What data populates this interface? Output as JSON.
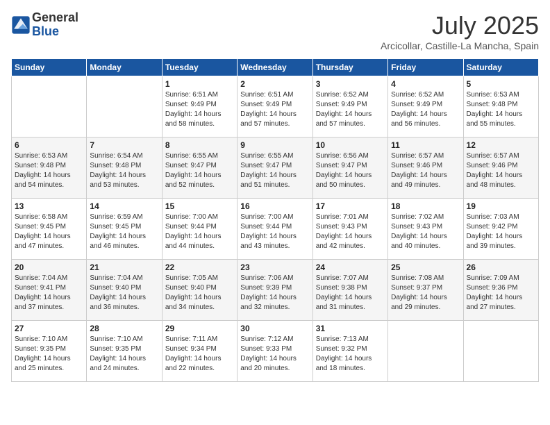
{
  "header": {
    "logo_general": "General",
    "logo_blue": "Blue",
    "month_year": "July 2025",
    "location": "Arcicollar, Castille-La Mancha, Spain"
  },
  "weekdays": [
    "Sunday",
    "Monday",
    "Tuesday",
    "Wednesday",
    "Thursday",
    "Friday",
    "Saturday"
  ],
  "weeks": [
    [
      {
        "day": "",
        "sunrise": "",
        "sunset": "",
        "daylight": ""
      },
      {
        "day": "",
        "sunrise": "",
        "sunset": "",
        "daylight": ""
      },
      {
        "day": "1",
        "sunrise": "Sunrise: 6:51 AM",
        "sunset": "Sunset: 9:49 PM",
        "daylight": "Daylight: 14 hours and 58 minutes."
      },
      {
        "day": "2",
        "sunrise": "Sunrise: 6:51 AM",
        "sunset": "Sunset: 9:49 PM",
        "daylight": "Daylight: 14 hours and 57 minutes."
      },
      {
        "day": "3",
        "sunrise": "Sunrise: 6:52 AM",
        "sunset": "Sunset: 9:49 PM",
        "daylight": "Daylight: 14 hours and 57 minutes."
      },
      {
        "day": "4",
        "sunrise": "Sunrise: 6:52 AM",
        "sunset": "Sunset: 9:49 PM",
        "daylight": "Daylight: 14 hours and 56 minutes."
      },
      {
        "day": "5",
        "sunrise": "Sunrise: 6:53 AM",
        "sunset": "Sunset: 9:48 PM",
        "daylight": "Daylight: 14 hours and 55 minutes."
      }
    ],
    [
      {
        "day": "6",
        "sunrise": "Sunrise: 6:53 AM",
        "sunset": "Sunset: 9:48 PM",
        "daylight": "Daylight: 14 hours and 54 minutes."
      },
      {
        "day": "7",
        "sunrise": "Sunrise: 6:54 AM",
        "sunset": "Sunset: 9:48 PM",
        "daylight": "Daylight: 14 hours and 53 minutes."
      },
      {
        "day": "8",
        "sunrise": "Sunrise: 6:55 AM",
        "sunset": "Sunset: 9:47 PM",
        "daylight": "Daylight: 14 hours and 52 minutes."
      },
      {
        "day": "9",
        "sunrise": "Sunrise: 6:55 AM",
        "sunset": "Sunset: 9:47 PM",
        "daylight": "Daylight: 14 hours and 51 minutes."
      },
      {
        "day": "10",
        "sunrise": "Sunrise: 6:56 AM",
        "sunset": "Sunset: 9:47 PM",
        "daylight": "Daylight: 14 hours and 50 minutes."
      },
      {
        "day": "11",
        "sunrise": "Sunrise: 6:57 AM",
        "sunset": "Sunset: 9:46 PM",
        "daylight": "Daylight: 14 hours and 49 minutes."
      },
      {
        "day": "12",
        "sunrise": "Sunrise: 6:57 AM",
        "sunset": "Sunset: 9:46 PM",
        "daylight": "Daylight: 14 hours and 48 minutes."
      }
    ],
    [
      {
        "day": "13",
        "sunrise": "Sunrise: 6:58 AM",
        "sunset": "Sunset: 9:45 PM",
        "daylight": "Daylight: 14 hours and 47 minutes."
      },
      {
        "day": "14",
        "sunrise": "Sunrise: 6:59 AM",
        "sunset": "Sunset: 9:45 PM",
        "daylight": "Daylight: 14 hours and 46 minutes."
      },
      {
        "day": "15",
        "sunrise": "Sunrise: 7:00 AM",
        "sunset": "Sunset: 9:44 PM",
        "daylight": "Daylight: 14 hours and 44 minutes."
      },
      {
        "day": "16",
        "sunrise": "Sunrise: 7:00 AM",
        "sunset": "Sunset: 9:44 PM",
        "daylight": "Daylight: 14 hours and 43 minutes."
      },
      {
        "day": "17",
        "sunrise": "Sunrise: 7:01 AM",
        "sunset": "Sunset: 9:43 PM",
        "daylight": "Daylight: 14 hours and 42 minutes."
      },
      {
        "day": "18",
        "sunrise": "Sunrise: 7:02 AM",
        "sunset": "Sunset: 9:43 PM",
        "daylight": "Daylight: 14 hours and 40 minutes."
      },
      {
        "day": "19",
        "sunrise": "Sunrise: 7:03 AM",
        "sunset": "Sunset: 9:42 PM",
        "daylight": "Daylight: 14 hours and 39 minutes."
      }
    ],
    [
      {
        "day": "20",
        "sunrise": "Sunrise: 7:04 AM",
        "sunset": "Sunset: 9:41 PM",
        "daylight": "Daylight: 14 hours and 37 minutes."
      },
      {
        "day": "21",
        "sunrise": "Sunrise: 7:04 AM",
        "sunset": "Sunset: 9:40 PM",
        "daylight": "Daylight: 14 hours and 36 minutes."
      },
      {
        "day": "22",
        "sunrise": "Sunrise: 7:05 AM",
        "sunset": "Sunset: 9:40 PM",
        "daylight": "Daylight: 14 hours and 34 minutes."
      },
      {
        "day": "23",
        "sunrise": "Sunrise: 7:06 AM",
        "sunset": "Sunset: 9:39 PM",
        "daylight": "Daylight: 14 hours and 32 minutes."
      },
      {
        "day": "24",
        "sunrise": "Sunrise: 7:07 AM",
        "sunset": "Sunset: 9:38 PM",
        "daylight": "Daylight: 14 hours and 31 minutes."
      },
      {
        "day": "25",
        "sunrise": "Sunrise: 7:08 AM",
        "sunset": "Sunset: 9:37 PM",
        "daylight": "Daylight: 14 hours and 29 minutes."
      },
      {
        "day": "26",
        "sunrise": "Sunrise: 7:09 AM",
        "sunset": "Sunset: 9:36 PM",
        "daylight": "Daylight: 14 hours and 27 minutes."
      }
    ],
    [
      {
        "day": "27",
        "sunrise": "Sunrise: 7:10 AM",
        "sunset": "Sunset: 9:35 PM",
        "daylight": "Daylight: 14 hours and 25 minutes."
      },
      {
        "day": "28",
        "sunrise": "Sunrise: 7:10 AM",
        "sunset": "Sunset: 9:35 PM",
        "daylight": "Daylight: 14 hours and 24 minutes."
      },
      {
        "day": "29",
        "sunrise": "Sunrise: 7:11 AM",
        "sunset": "Sunset: 9:34 PM",
        "daylight": "Daylight: 14 hours and 22 minutes."
      },
      {
        "day": "30",
        "sunrise": "Sunrise: 7:12 AM",
        "sunset": "Sunset: 9:33 PM",
        "daylight": "Daylight: 14 hours and 20 minutes."
      },
      {
        "day": "31",
        "sunrise": "Sunrise: 7:13 AM",
        "sunset": "Sunset: 9:32 PM",
        "daylight": "Daylight: 14 hours and 18 minutes."
      },
      {
        "day": "",
        "sunrise": "",
        "sunset": "",
        "daylight": ""
      },
      {
        "day": "",
        "sunrise": "",
        "sunset": "",
        "daylight": ""
      }
    ]
  ]
}
